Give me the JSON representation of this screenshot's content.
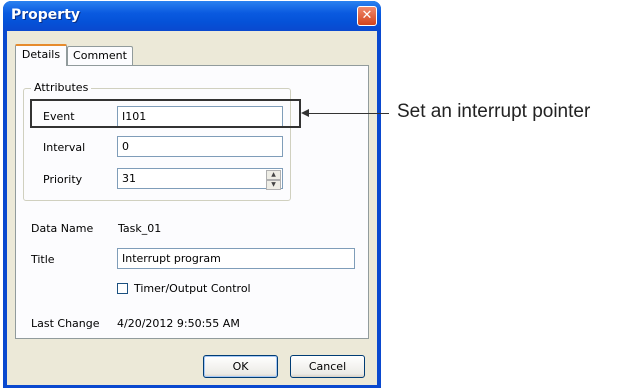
{
  "dialog": {
    "title": "Property",
    "close_symbol": "✕",
    "tabs": [
      {
        "label": "Details",
        "active": true
      },
      {
        "label": "Comment",
        "active": false
      }
    ],
    "attributes": {
      "group_label": "Attributes",
      "event_label": "Event",
      "event_value": "I101",
      "interval_label": "Interval",
      "interval_value": "0",
      "priority_label": "Priority",
      "priority_value": "31"
    },
    "data_name_label": "Data Name",
    "data_name_value": "Task_01",
    "title_label": "Title",
    "title_value": "Interrupt program",
    "timer_checkbox_label": "Timer/Output Control",
    "timer_checkbox_checked": false,
    "last_change_label": "Last Change",
    "last_change_value": "4/20/2012 9:50:55 AM",
    "ok_label": "OK",
    "cancel_label": "Cancel"
  },
  "annotation": {
    "callout_text": "Set an interrupt pointer"
  },
  "colors": {
    "titlebar": "#0a5ae0",
    "dialog_bg": "#ece9d8",
    "close_button": "#d3431c"
  }
}
